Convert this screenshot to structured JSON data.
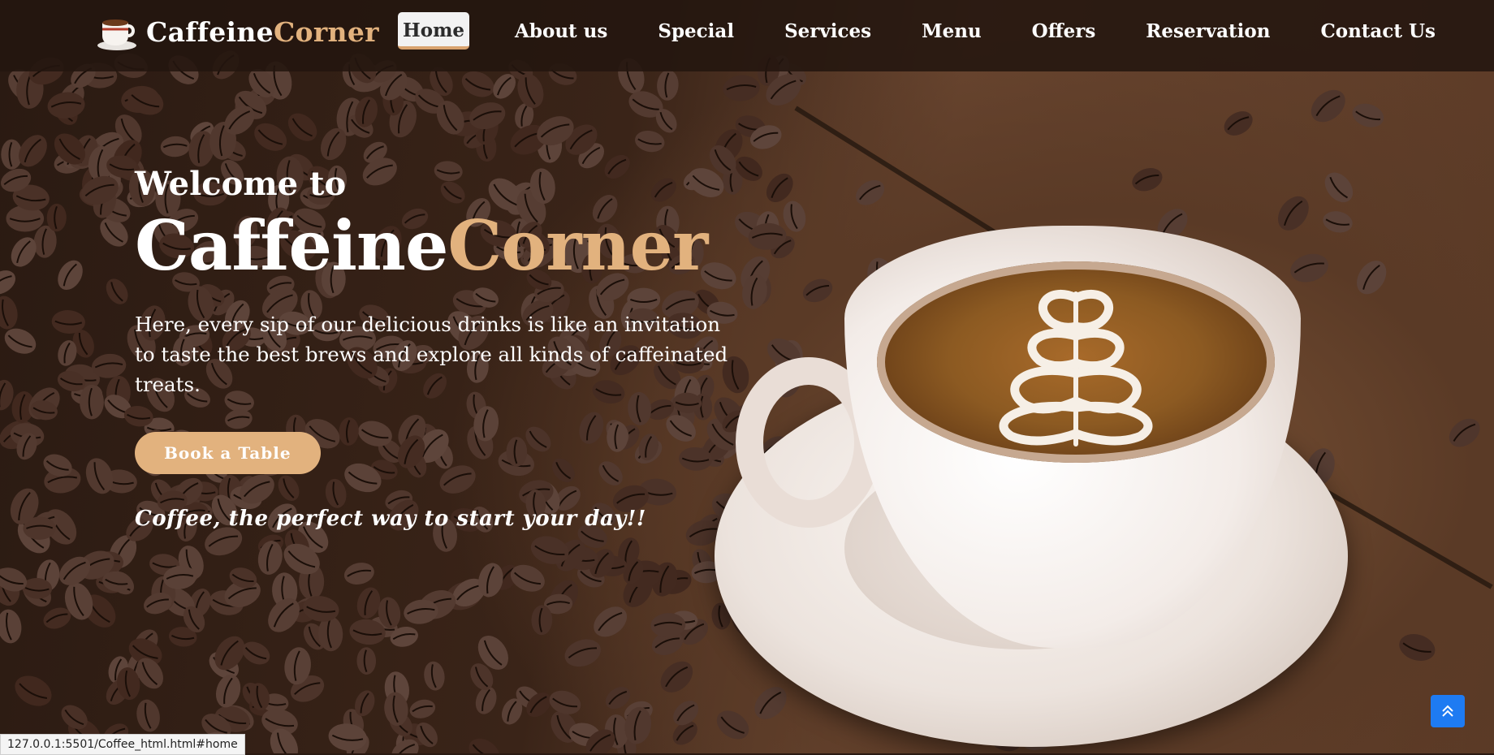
{
  "brand": {
    "first": "Caffeine",
    "second": "Corner",
    "accent_color": "#e2b27e",
    "icon": "coffee-cup-icon"
  },
  "nav": {
    "items": [
      {
        "label": "Home",
        "active": true
      },
      {
        "label": "About us"
      },
      {
        "label": "Special"
      },
      {
        "label": "Services"
      },
      {
        "label": "Menu"
      },
      {
        "label": "Offers"
      },
      {
        "label": "Reservation"
      },
      {
        "label": "Contact Us"
      }
    ]
  },
  "hero": {
    "welcome": "Welcome to",
    "title_first": "Caffeine",
    "title_second": "Corner",
    "description": "Here, every sip of our delicious drinks is like an invitation to taste the best brews and explore all kinds of caffeinated treats.",
    "cta_label": "Book a Table",
    "tagline": "Coffee, the perfect way to start your day!!"
  },
  "scroll_top": {
    "icon": "double-chevron-up-icon",
    "color": "#1e7bf2"
  },
  "status_bar": {
    "url": "127.0.0.1:5501/Coffee_html.html#home"
  }
}
